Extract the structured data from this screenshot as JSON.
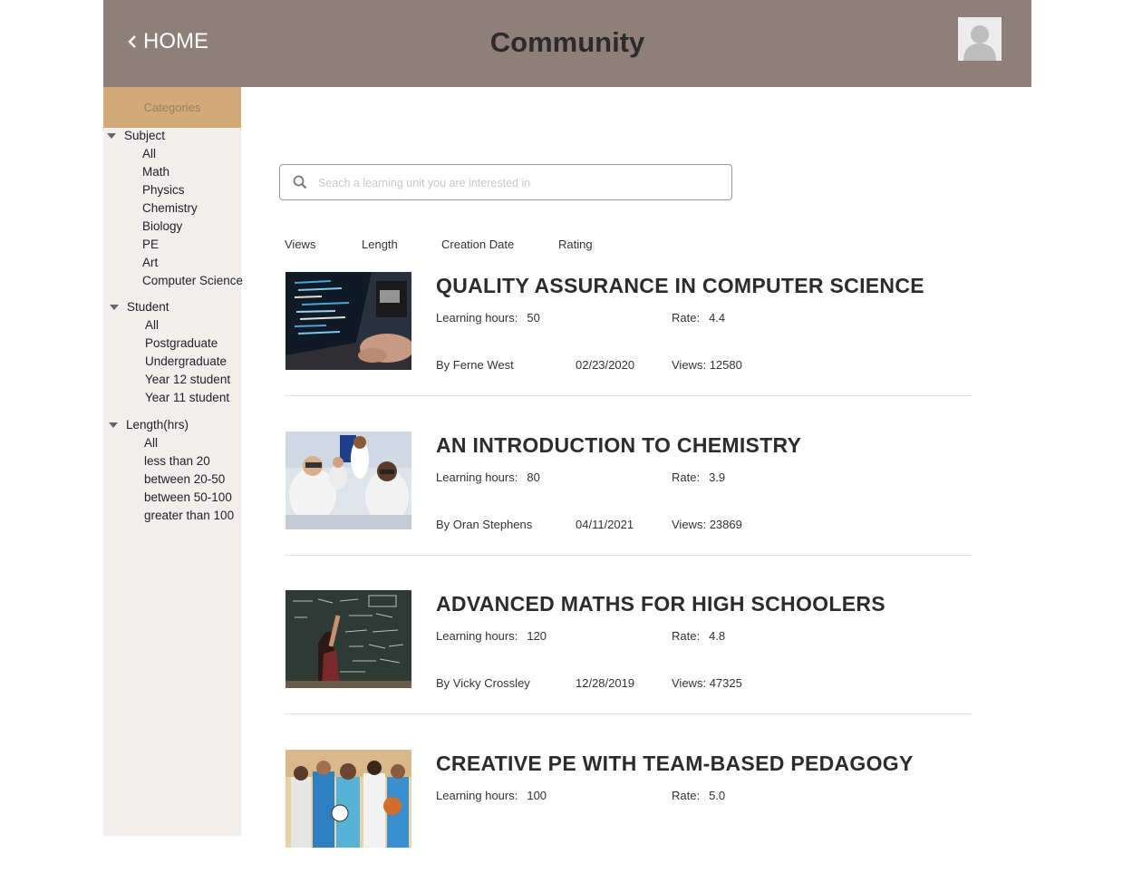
{
  "header": {
    "home_label": "HOME",
    "title": "Community"
  },
  "sidebar": {
    "heading": "Categories",
    "groups": [
      {
        "title": "Subject",
        "items": [
          "All",
          "Math",
          "Physics",
          "Chemistry",
          "Biology",
          "PE",
          "Art",
          "Computer Science"
        ]
      },
      {
        "title": "Student",
        "items": [
          "All",
          "Postgraduate",
          "Undergraduate",
          "Year 12 student",
          "Year 11 student"
        ]
      },
      {
        "title": "Length(hrs)",
        "items": [
          "All",
          "less than 20",
          "between 20-50",
          "between 50-100",
          "greater than 100"
        ]
      }
    ]
  },
  "search": {
    "placeholder": "Seach a learning unit you are interested in",
    "value": ""
  },
  "sort_options": [
    "Views",
    "Length",
    "Creation Date",
    "Rating"
  ],
  "labels": {
    "hours": "Learning hours:",
    "rate": "Rate:",
    "by": "By",
    "views": "Views:"
  },
  "courses": [
    {
      "title": "QUALITY ASSURANCE IN COMPUTER SCIENCE",
      "hours": "50",
      "rate": "4.4",
      "author": "Ferne West",
      "date": "02/23/2020",
      "views": "12580",
      "image": "laptop-code-photo"
    },
    {
      "title": "AN INTRODUCTION TO CHEMISTRY",
      "hours": "80",
      "rate": "3.9",
      "author": "Oran Stephens",
      "date": "04/11/2021",
      "views": "23869",
      "image": "chemistry-lab-photo"
    },
    {
      "title": "ADVANCED MATHS FOR HIGH SCHOOLERS",
      "hours": "120",
      "rate": "4.8",
      "author": "Vicky Crossley",
      "date": "12/28/2019",
      "views": "47325",
      "image": "blackboard-photo"
    },
    {
      "title": "CREATIVE PE WITH TEAM-BASED PEDAGOGY",
      "hours": "100",
      "rate": "5.0",
      "image": "students-sports-photo"
    }
  ],
  "colors": {
    "header_bg": "#8f7f79",
    "category_header_bg": "#d2aa78",
    "sidebar_bg": "#f3eeee"
  }
}
